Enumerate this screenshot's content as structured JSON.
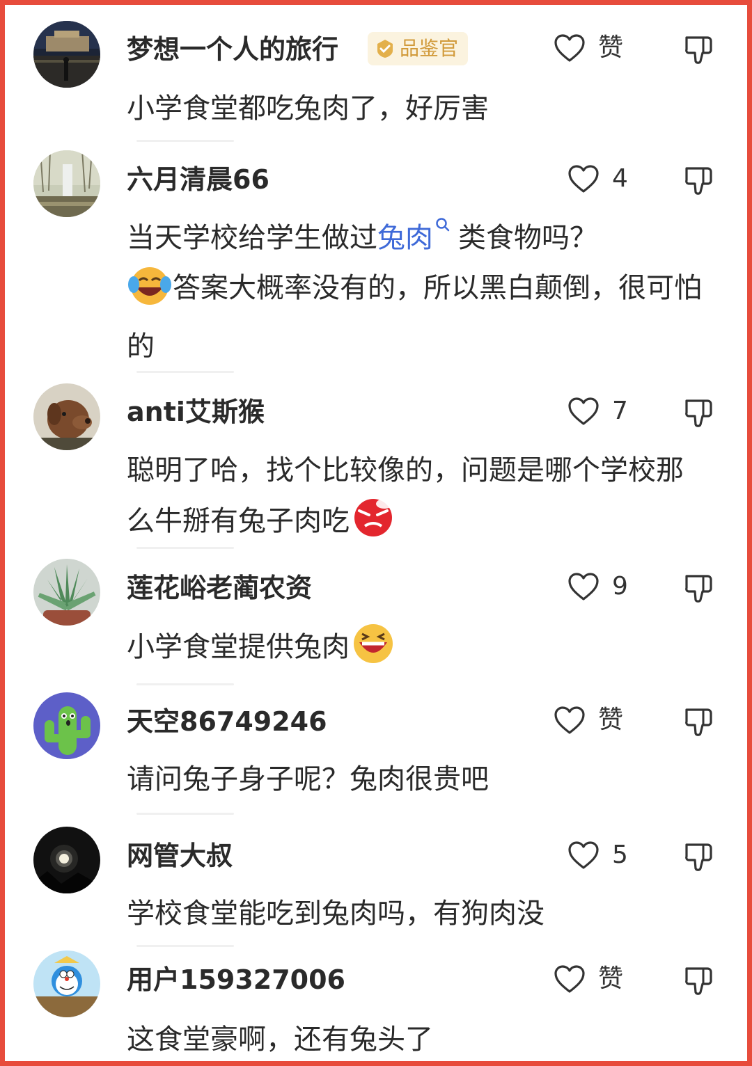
{
  "accent_color": "#e74c3c",
  "comments": [
    {
      "username": "梦想一个人的旅行",
      "badge": "品鉴官",
      "like_count": "赞",
      "text": "小学食堂都吃兔肉了，好厉害",
      "avatar_icon": "night-palace-photo-icon"
    },
    {
      "username": "六月清晨66",
      "like_count": "4",
      "text_before": "当天学校给学生做过",
      "text_link": "兔肉",
      "text_after": "类食物吗？",
      "text_line2": "答案大概率没有的，所以黑白颠倒，很可怕的",
      "avatar_icon": "snowy-waterfall-photo-icon"
    },
    {
      "username": "anti艾斯猴",
      "like_count": "7",
      "text": "聪明了哈，找个比较像的，问题是哪个学校那么牛掰有兔子肉吃",
      "avatar_icon": "dog-photo-icon"
    },
    {
      "username": "莲花峪老蔺农资",
      "like_count": "9",
      "text": "小学食堂提供兔肉",
      "avatar_icon": "succulent-photo-icon"
    },
    {
      "username": "天空86749246",
      "like_count": "赞",
      "text": "请问兔子身子呢？兔肉很贵吧",
      "avatar_icon": "cactus-cartoon-icon"
    },
    {
      "username": "网管大叔",
      "like_count": "5",
      "text": "学校食堂能吃到兔肉吗，有狗肉没",
      "avatar_icon": "moon-night-photo-icon"
    },
    {
      "username": "用户159327006",
      "like_count": "赞",
      "text": "这食堂豪啊，还有兔头了",
      "avatar_icon": "doraemon-cartoon-icon"
    }
  ]
}
